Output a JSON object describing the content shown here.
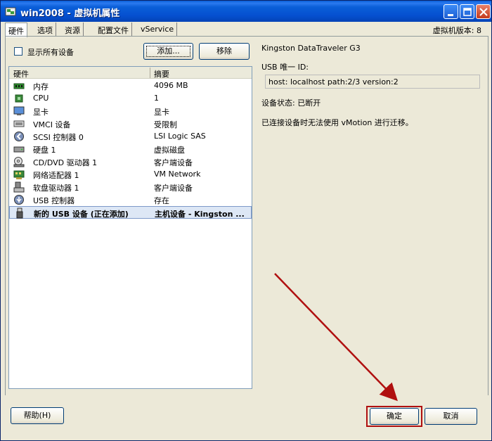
{
  "window": {
    "title": "win2008 - 虚拟机属性"
  },
  "tabs": [
    {
      "label": "硬件"
    },
    {
      "label": "选项"
    },
    {
      "label": "资源"
    },
    {
      "label": "配置文件"
    },
    {
      "label": "vService"
    }
  ],
  "version_label": "虚拟机版本: 8",
  "show_all": {
    "label": "显示所有设备",
    "checked": false
  },
  "buttons": {
    "add": "添加...",
    "remove": "移除",
    "help": "帮助(H)",
    "ok": "确定",
    "cancel": "取消"
  },
  "hardware_list": {
    "headers": {
      "hardware": "硬件",
      "summary": "摘要"
    },
    "rows": [
      {
        "name": "内存",
        "summary": "4096 MB",
        "icon": "memory-icon"
      },
      {
        "name": "CPU",
        "summary": "1",
        "icon": "cpu-icon"
      },
      {
        "name": "显卡",
        "summary": "显卡",
        "icon": "monitor-icon"
      },
      {
        "name": "VMCI 设备",
        "summary": "受限制",
        "icon": "vmci-icon"
      },
      {
        "name": "SCSI 控制器 0",
        "summary": "LSI Logic SAS",
        "icon": "scsi-icon"
      },
      {
        "name": "硬盘 1",
        "summary": "虚拟磁盘",
        "icon": "harddisk-icon"
      },
      {
        "name": "CD/DVD 驱动器 1",
        "summary": "客户端设备",
        "icon": "cdrom-icon"
      },
      {
        "name": "网络适配器 1",
        "summary": "VM Network",
        "icon": "network-icon"
      },
      {
        "name": "软盘驱动器 1",
        "summary": "客户端设备",
        "icon": "floppy-icon"
      },
      {
        "name": "USB 控制器",
        "summary": "存在",
        "icon": "usb-icon"
      },
      {
        "name": "新的 USB 设备 (正在添加)",
        "summary": "主机设备 - Kingston ...",
        "icon": "usb-device-icon",
        "selected": true
      }
    ]
  },
  "details": {
    "device_name": "Kingston DataTraveler G3",
    "usb_id_label": "USB 唯一 ID:",
    "usb_id_value": "host: localhost path:2/3 version:2",
    "status": "设备状态: 已断开",
    "vmotion_note": "已连接设备时无法使用 vMotion 进行迁移。"
  },
  "colors": {
    "titlebar": "#0a5fd8",
    "highlight": "#b01010",
    "selection": "#dde7f5"
  }
}
